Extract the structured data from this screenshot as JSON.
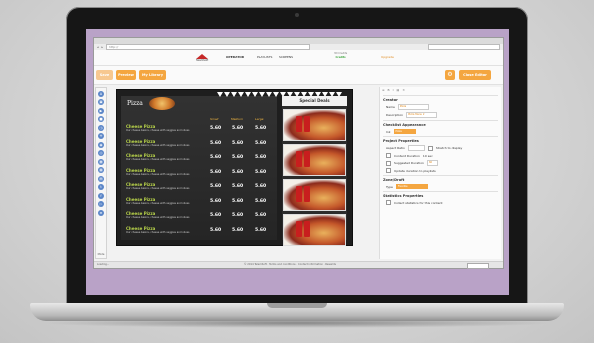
{
  "browser": {
    "url": "http://",
    "search_placeholder": ""
  },
  "header": {
    "logo_text": "TelemSoft",
    "nav": [
      "OPERATOR",
      "PLAYLISTS",
      "SCREENS"
    ],
    "credits_label": "3D Credits",
    "credits_value": "Credits",
    "upgrade_label": "Upgrade"
  },
  "toolbar": {
    "save_label": "Save",
    "preview_label": "Preview",
    "library_label": "My Library",
    "close_label": "Close Editor"
  },
  "tools": {
    "icons": [
      "text-icon",
      "image-icon",
      "video-icon",
      "shape-icon",
      "clock-icon",
      "weather-icon",
      "rss-icon",
      "web-icon",
      "table-icon",
      "qr-icon",
      "grid-icon",
      "twitter-icon",
      "facebook-icon",
      "youtube-icon",
      "playlist-icon"
    ],
    "glyphs": [
      "A",
      "▣",
      "▶",
      "■",
      "◷",
      "☀",
      "◉",
      "◎",
      "▦",
      "▩",
      "▤",
      "t",
      "f",
      "▷",
      "≡"
    ],
    "mode_label": "Mode"
  },
  "menu_board": {
    "title": "Pizza",
    "columns": [
      "Small",
      "Medium",
      "Large"
    ],
    "items": [
      {
        "name": "Cheese Pizza",
        "desc": "Our cheese basics, cheese with veggies and olives",
        "small": "5.60",
        "medium": "5.60",
        "large": "5.60"
      },
      {
        "name": "Cheese Pizza",
        "desc": "Our cheese basics, cheese with veggies and olives",
        "small": "5.60",
        "medium": "5.60",
        "large": "5.60"
      },
      {
        "name": "Cheese Pizza",
        "desc": "Our cheese basics, cheese with veggies and olives",
        "small": "5.60",
        "medium": "5.60",
        "large": "5.60"
      },
      {
        "name": "Cheese Pizza",
        "desc": "Our cheese basics, cheese with veggies and olives",
        "small": "5.60",
        "medium": "5.60",
        "large": "5.60"
      },
      {
        "name": "Cheese Pizza",
        "desc": "Our cheese basics, cheese with veggies and olives",
        "small": "5.60",
        "medium": "5.60",
        "large": "5.60"
      },
      {
        "name": "Cheese Pizza",
        "desc": "Our cheese basics, cheese with veggies and olives",
        "small": "5.60",
        "medium": "5.60",
        "large": "5.60"
      },
      {
        "name": "Cheese Pizza",
        "desc": "Our cheese basics, cheese with veggies and olives",
        "small": "5.60",
        "medium": "5.60",
        "large": "5.60"
      },
      {
        "name": "Cheese Pizza",
        "desc": "Our cheese basics, cheese with veggies and olives",
        "small": "5.60",
        "medium": "5.60",
        "large": "5.60"
      }
    ],
    "deals_title": "Special Deals"
  },
  "properties": {
    "section_creator": "Creator",
    "name_label": "Name",
    "name_value": "Pizza",
    "description_label": "Description",
    "description_value": "Pizza Menu 2",
    "section_appearance": "Checklist Appearance",
    "ink_label": "Ink",
    "ink_value": "Pizza",
    "section_project": "Project Properties",
    "aspect_label": "Aspect Ratio",
    "aspect_note": "Stretch to display",
    "content_duration_label": "Content Duration",
    "content_duration_value": "10 sec",
    "suggested_label": "Suggested Duration",
    "suggested_value": "60",
    "update_label": "Update duration to playlists",
    "section_zone": "Zone/Draft",
    "type_label": "Type",
    "type_value": "Flexible",
    "section_statistics": "Statistics Properties",
    "statistics_label": "Collect statistics for this content"
  },
  "status": {
    "left": "Loading...",
    "center": "© 2014 TelemSoft · Terms and conditions · Contact information · Rewards"
  },
  "colors": {
    "accent": "#f4a640",
    "price": "#ffffff",
    "item_name": "#b9d44a",
    "tool_icon": "#5b86c8"
  }
}
